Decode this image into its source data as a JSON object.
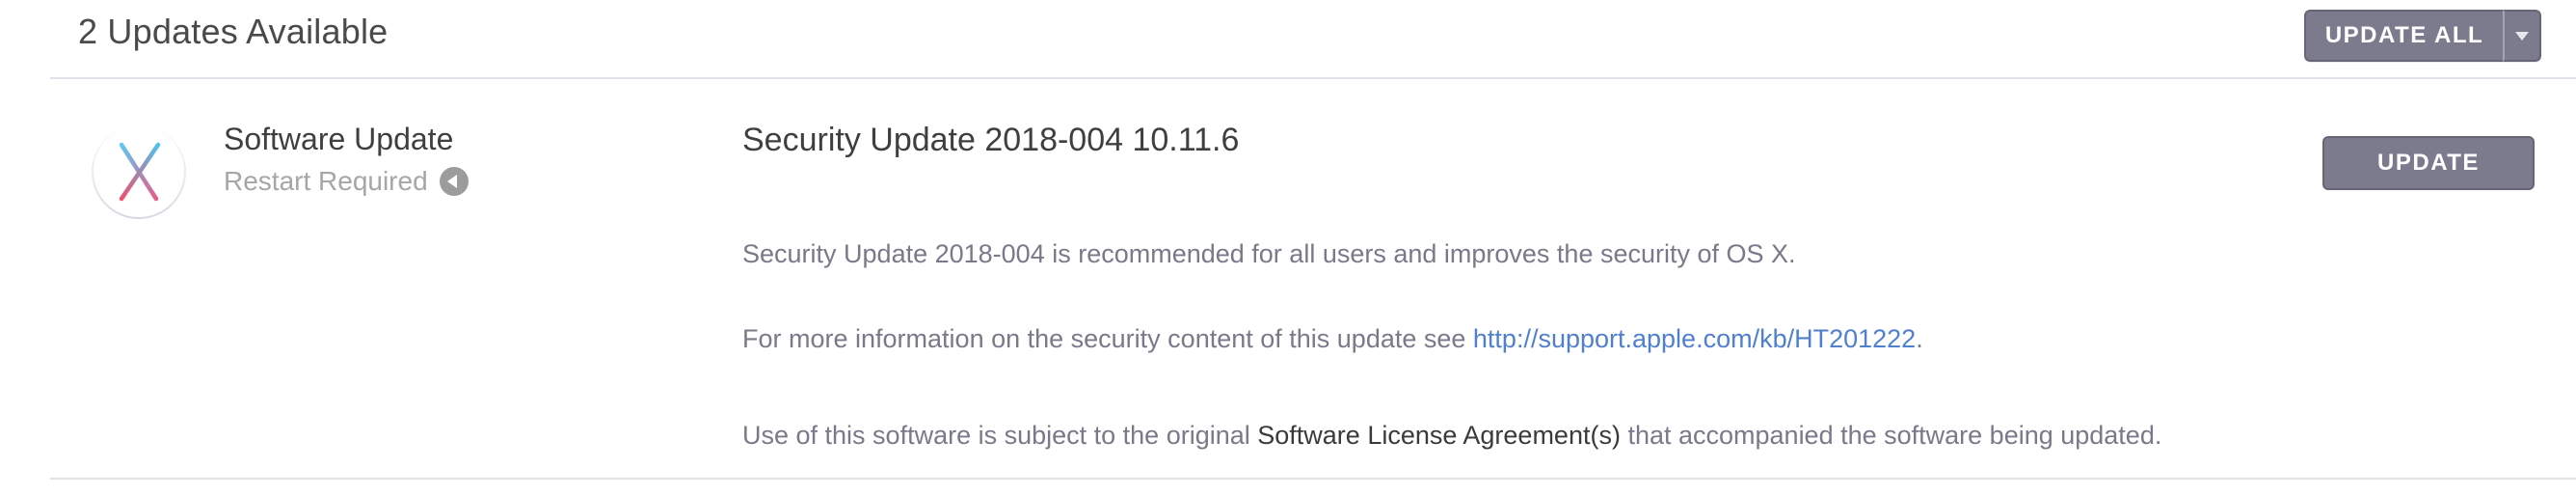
{
  "header": {
    "title": "2 Updates Available",
    "update_all_label": "UPDATE ALL"
  },
  "update_item": {
    "app_name": "Software Update",
    "status": "Restart Required",
    "title": "Security Update 2018-004 10.11.6",
    "update_label": "UPDATE",
    "description_1": "Security Update 2018-004 is recommended for all users and improves the security of OS X.",
    "description_2_prefix": "For more information on the security content of this update see ",
    "description_2_link": "http://support.apple.com/kb/HT201222",
    "description_2_suffix": ".",
    "description_3_prefix": "Use of this software is subject to the original ",
    "description_3_link": "Software License Agreement(s)",
    "description_3_suffix": " that accompanied the software being updated."
  },
  "colors": {
    "button_bg": "#7c7b8e",
    "link": "#4f7fce",
    "description_text": "#797989",
    "divider": "#e1e1ea"
  },
  "icons": {
    "app_icon": "os-x-logo-icon",
    "restart_icon": "restart-arrow-icon",
    "dropdown_icon": "chevron-down-icon"
  }
}
